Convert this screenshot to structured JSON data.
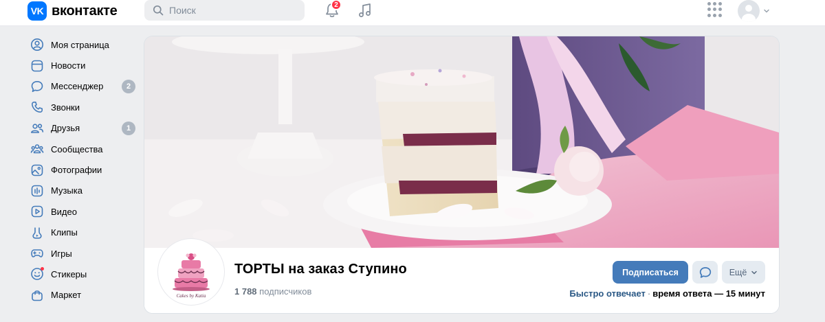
{
  "header": {
    "logo_mark": "VK",
    "logo_text": "вконтакте",
    "search_placeholder": "Поиск",
    "notifications_count": "2"
  },
  "sidebar": {
    "items": [
      {
        "label": "Моя страница",
        "icon": "user-circle-icon"
      },
      {
        "label": "Новости",
        "icon": "newsfeed-icon"
      },
      {
        "label": "Мессенджер",
        "icon": "message-icon",
        "count": "2"
      },
      {
        "label": "Звонки",
        "icon": "phone-icon"
      },
      {
        "label": "Друзья",
        "icon": "users-icon",
        "count": "1"
      },
      {
        "label": "Сообщества",
        "icon": "communities-icon"
      },
      {
        "label": "Фотографии",
        "icon": "picture-icon"
      },
      {
        "label": "Музыка",
        "icon": "music-icon"
      },
      {
        "label": "Видео",
        "icon": "video-icon"
      },
      {
        "label": "Клипы",
        "icon": "clips-icon"
      },
      {
        "label": "Игры",
        "icon": "gamepad-icon"
      },
      {
        "label": "Стикеры",
        "icon": "smile-icon"
      },
      {
        "label": "Маркет",
        "icon": "bag-icon"
      }
    ]
  },
  "group": {
    "name": "ТОРТЫ на заказ Ступино",
    "subscribers_count": "1 788",
    "subscribers_label": "подписчиков",
    "subscribe_label": "Подписаться",
    "more_label": "Ещё",
    "reply_fast": "Быстро отвечает",
    "reply_sep": "·",
    "reply_time": "время ответа — 15 минут",
    "avatar_caption": "Cakes by Katia"
  },
  "colors": {
    "accent": "#447bba",
    "brand": "#0077ff",
    "badge": "#ff3347"
  }
}
